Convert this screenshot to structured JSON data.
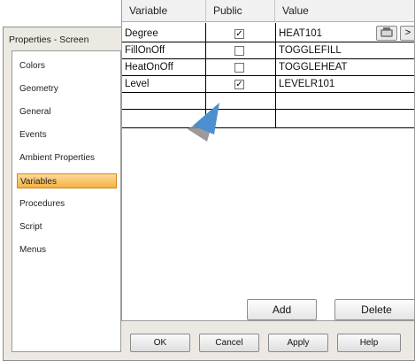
{
  "dialog": {
    "title": "Properties - Screen"
  },
  "sidebar": {
    "items": [
      {
        "label": "Colors"
      },
      {
        "label": "Geometry"
      },
      {
        "label": "General"
      },
      {
        "label": "Events"
      },
      {
        "label": "Ambient Properties"
      },
      {
        "label": "Variables",
        "selected": true
      },
      {
        "label": "Procedures"
      },
      {
        "label": "Script"
      },
      {
        "label": "Menus"
      }
    ]
  },
  "table": {
    "columns": [
      "Variable",
      "Public",
      "Value"
    ],
    "rows": [
      {
        "variable": "Degree",
        "public": true,
        "value": "HEAT101"
      },
      {
        "variable": "FillOnOff",
        "public": false,
        "value": "TOGGLEFILL"
      },
      {
        "variable": "HeatOnOff",
        "public": false,
        "value": "TOGGLEHEAT"
      },
      {
        "variable": "Level",
        "public": true,
        "value": "LEVELR101"
      },
      {
        "variable": "",
        "public": null,
        "value": ""
      }
    ],
    "cell_buttons": {
      "more_label": ">"
    }
  },
  "panel_buttons": {
    "add": "Add",
    "delete": "Delete"
  },
  "dialog_buttons": {
    "ok": "OK",
    "cancel": "Cancel",
    "apply": "Apply",
    "help": "Help"
  },
  "colors": {
    "selection": "#f5b23f",
    "cursor": "#4b8fcf"
  }
}
